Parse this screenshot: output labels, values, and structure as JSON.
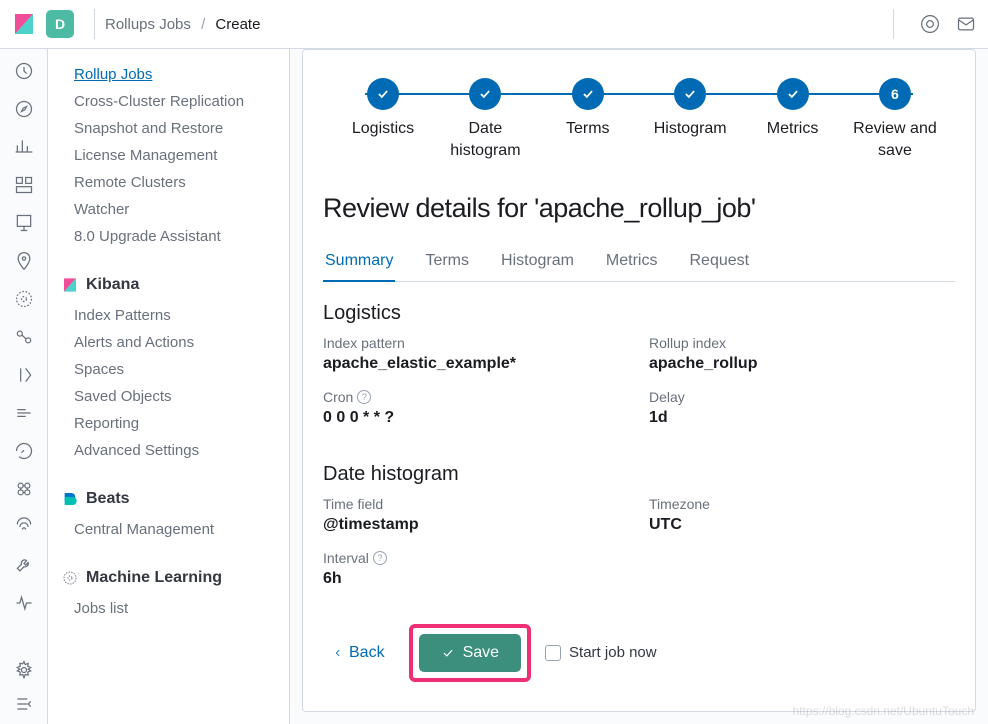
{
  "header": {
    "space_letter": "D",
    "breadcrumb_parent": "Rollups Jobs",
    "breadcrumb_current": "Create"
  },
  "sidebar": {
    "stack_items": [
      "Rollup Jobs",
      "Cross-Cluster Replication",
      "Snapshot and Restore",
      "License Management",
      "Remote Clusters",
      "Watcher",
      "8.0 Upgrade Assistant"
    ],
    "kibana_title": "Kibana",
    "kibana_items": [
      "Index Patterns",
      "Alerts and Actions",
      "Spaces",
      "Saved Objects",
      "Reporting",
      "Advanced Settings"
    ],
    "beats_title": "Beats",
    "beats_items": [
      "Central Management"
    ],
    "ml_title": "Machine Learning",
    "ml_items": [
      "Jobs list"
    ]
  },
  "steps": [
    {
      "label": "Logistics",
      "done": true
    },
    {
      "label": "Date histogram",
      "done": true
    },
    {
      "label": "Terms",
      "done": true
    },
    {
      "label": "Histogram",
      "done": true
    },
    {
      "label": "Metrics",
      "done": true
    },
    {
      "label": "Review and save",
      "number": "6"
    }
  ],
  "page_title": "Review details for 'apache_rollup_job'",
  "tabs": [
    "Summary",
    "Terms",
    "Histogram",
    "Metrics",
    "Request"
  ],
  "active_tab": 0,
  "summary": {
    "logistics_title": "Logistics",
    "index_pattern_label": "Index pattern",
    "index_pattern_value": "apache_elastic_example*",
    "rollup_index_label": "Rollup index",
    "rollup_index_value": "apache_rollup",
    "cron_label": "Cron",
    "cron_value": "0 0 0 * * ?",
    "delay_label": "Delay",
    "delay_value": "1d",
    "dh_title": "Date histogram",
    "time_field_label": "Time field",
    "time_field_value": "@timestamp",
    "timezone_label": "Timezone",
    "timezone_value": "UTC",
    "interval_label": "Interval",
    "interval_value": "6h"
  },
  "footer": {
    "back_label": "Back",
    "save_label": "Save",
    "start_job_label": "Start job now"
  },
  "watermark": "https://blog.csdn.net/UbuntuTouch"
}
